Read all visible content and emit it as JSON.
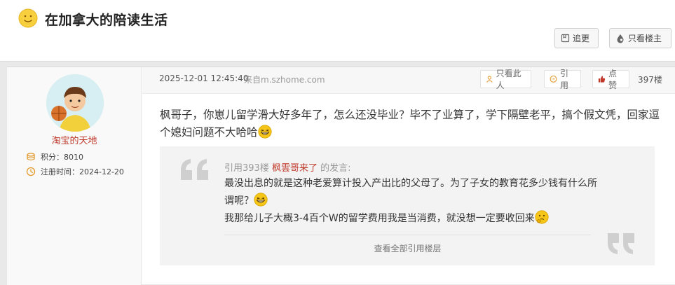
{
  "header": {
    "title": "在加拿大的陪读生活",
    "follow_label": "追更",
    "owner_only_label": "只看楼主"
  },
  "user": {
    "name": "淘宝的天地",
    "points_label": "积分：",
    "points_value": "8010",
    "reg_label": "注册时间：",
    "reg_value": "2024-12-20"
  },
  "post": {
    "time": "2025-12-01 12:45:40",
    "source": "来自m.szhome.com",
    "only_this_label": "只看此人",
    "quote_label": "引用",
    "like_label": "点赞",
    "floor": "397楼",
    "content": "枫哥子，你崽儿留学滑大好多年了，怎么还没毕业？毕不了业算了，学下隔壁老平，搞个假文凭，回家逗个媳妇问题不大哈哈"
  },
  "quote": {
    "prefix": "引用393楼",
    "user": "枫雲哥来了",
    "suffix": "的发言:",
    "line1": "最没出息的就是这种老爱算计投入产出比的父母了。为了子女的教育花多少钱有什么所谓呢？",
    "line2": "我那给儿子大概3-4百个W的留学费用我是当消费，就没想一定要收回来",
    "view_all": "查看全部引用楼层"
  },
  "colors": {
    "username": "#c0392b",
    "accent_orange": "#e39b2f",
    "emoji_yellow": "#f5c518"
  },
  "icons": [
    "smiley-icon",
    "bookmark-icon",
    "drop-icon",
    "coins-icon",
    "clock-icon",
    "person-icon",
    "chat-icon",
    "thumb-icon",
    "grin-icon",
    "thinking-icon",
    "open-quote-icon",
    "close-quote-icon"
  ]
}
